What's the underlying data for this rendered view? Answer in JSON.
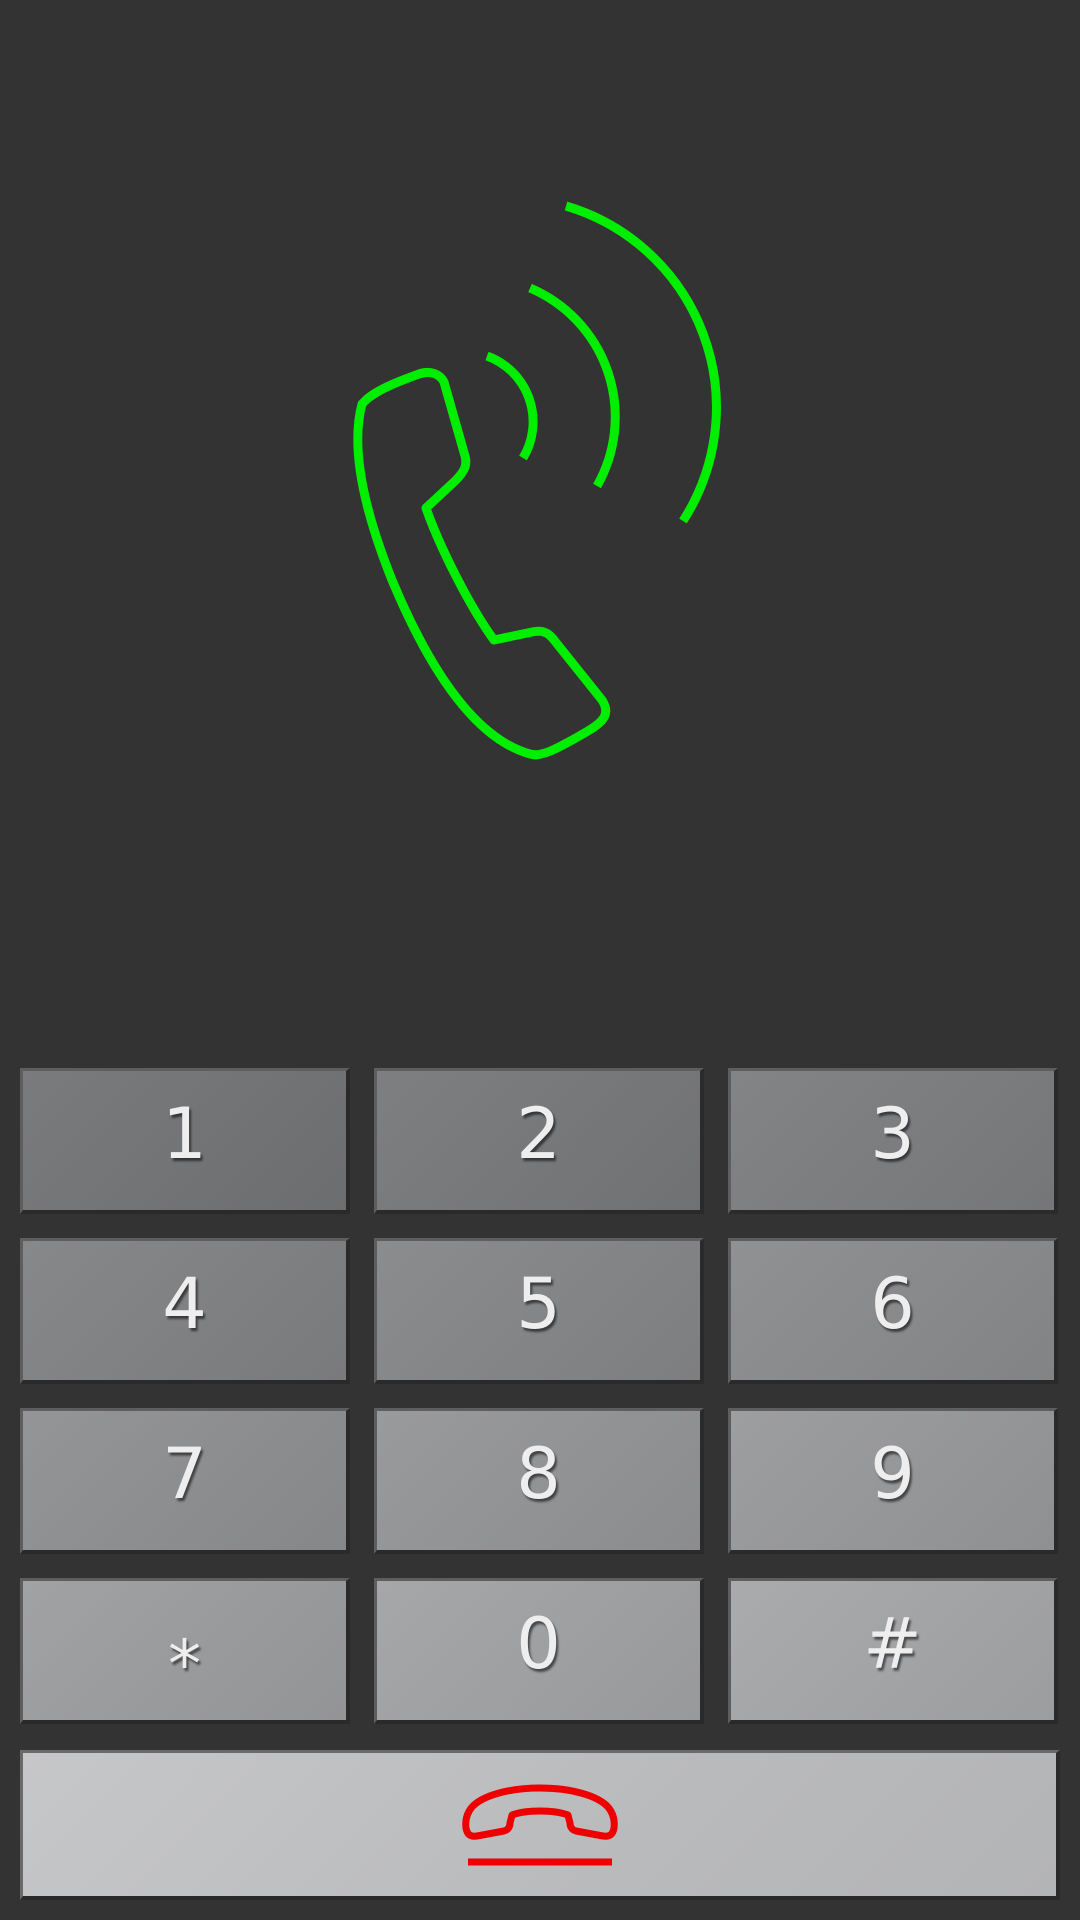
{
  "call_screen": {
    "status_icon": "phone-ringing-icon",
    "status_icon_color": "#00ee00"
  },
  "keypad": {
    "keys": [
      {
        "label": "1",
        "name": "key-1"
      },
      {
        "label": "2",
        "name": "key-2"
      },
      {
        "label": "3",
        "name": "key-3"
      },
      {
        "label": "4",
        "name": "key-4"
      },
      {
        "label": "5",
        "name": "key-5"
      },
      {
        "label": "6",
        "name": "key-6"
      },
      {
        "label": "7",
        "name": "key-7"
      },
      {
        "label": "8",
        "name": "key-8"
      },
      {
        "label": "9",
        "name": "key-9"
      },
      {
        "label": "*",
        "name": "key-star"
      },
      {
        "label": "0",
        "name": "key-0"
      },
      {
        "label": "#",
        "name": "key-hash"
      }
    ]
  },
  "end_call": {
    "icon": "hang-up-icon",
    "icon_color": "#ee0000"
  },
  "colors": {
    "background": "#333333",
    "key_text": "#eeeeee",
    "key_top": "#7a7b7d",
    "key_bottom": "#b0b1b3"
  }
}
